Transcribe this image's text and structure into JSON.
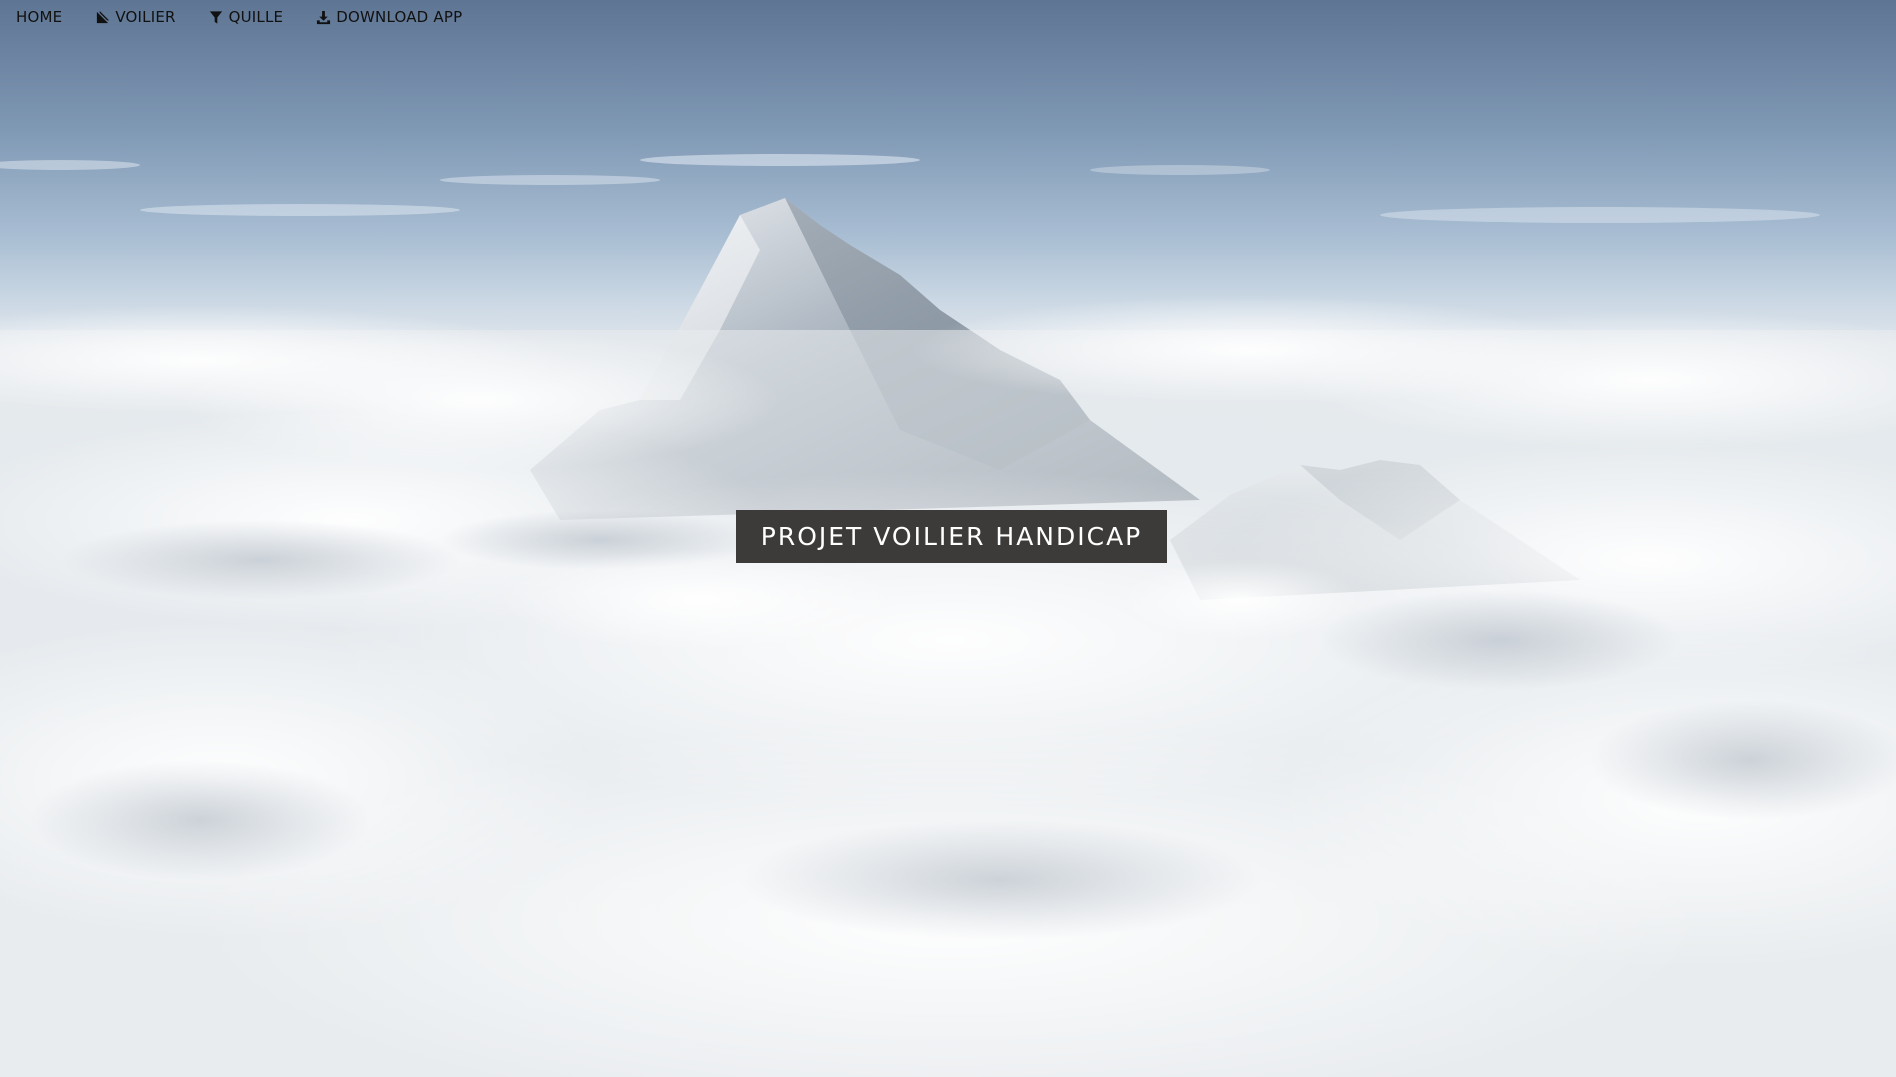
{
  "nav": {
    "items": [
      {
        "label": "HOME",
        "icon": ""
      },
      {
        "label": "VOILIER",
        "icon": "sailboat-icon"
      },
      {
        "label": "QUILLE",
        "icon": "filter-icon"
      },
      {
        "label": "DOWNLOAD APP",
        "icon": "download-icon"
      }
    ]
  },
  "hero": {
    "title": "PROJET VOILIER HANDICAP",
    "background": "mountain-peak-above-clouds",
    "colors": {
      "sky_top": "#5e7593",
      "clouds": "#e8ebef",
      "title_bg": "#3c3b3a",
      "title_text": "#ffffff"
    }
  }
}
